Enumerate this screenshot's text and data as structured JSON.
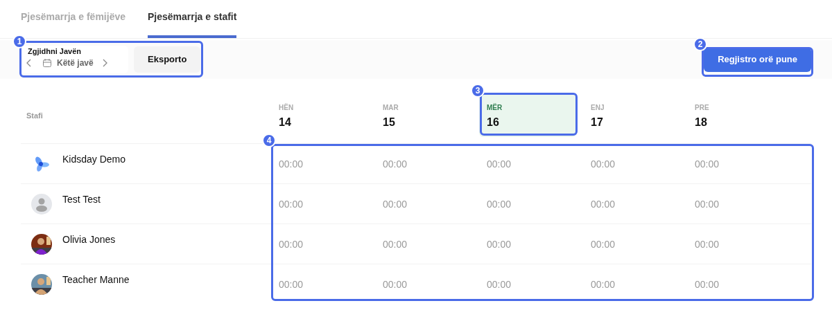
{
  "tabs": [
    {
      "label": "Pjesëmarrja e fëmijëve",
      "selected": false
    },
    {
      "label": "Pjesëmarrja e stafit",
      "selected": true
    }
  ],
  "week_picker": {
    "label": "Zgjidhni Javën",
    "value": "Këtë javë"
  },
  "export_button": "Eksporto",
  "register_button": "Regjistro orë pune",
  "table": {
    "staff_header": "Stafi",
    "days": [
      {
        "name": "HËN",
        "date": "14",
        "selected": false
      },
      {
        "name": "MAR",
        "date": "15",
        "selected": false
      },
      {
        "name": "MËR",
        "date": "16",
        "selected": true
      },
      {
        "name": "ENJ",
        "date": "17",
        "selected": false
      },
      {
        "name": "PRE",
        "date": "18",
        "selected": false
      }
    ],
    "rows": [
      {
        "name": "Kidsday Demo",
        "kind": "logo",
        "hours": [
          "00:00",
          "00:00",
          "00:00",
          "00:00",
          "00:00"
        ]
      },
      {
        "name": "Test Test",
        "kind": "placeholder",
        "hours": [
          "00:00",
          "00:00",
          "00:00",
          "00:00",
          "00:00"
        ]
      },
      {
        "name": "Olivia Jones",
        "kind": "picture",
        "hours": [
          "00:00",
          "00:00",
          "00:00",
          "00:00",
          "00:00"
        ]
      },
      {
        "name": "Teacher Manne",
        "kind": "picture",
        "hours": [
          "00:00",
          "00:00",
          "00:00",
          "00:00",
          "00:00"
        ]
      }
    ]
  },
  "callouts": [
    "1",
    "2",
    "3",
    "4"
  ]
}
